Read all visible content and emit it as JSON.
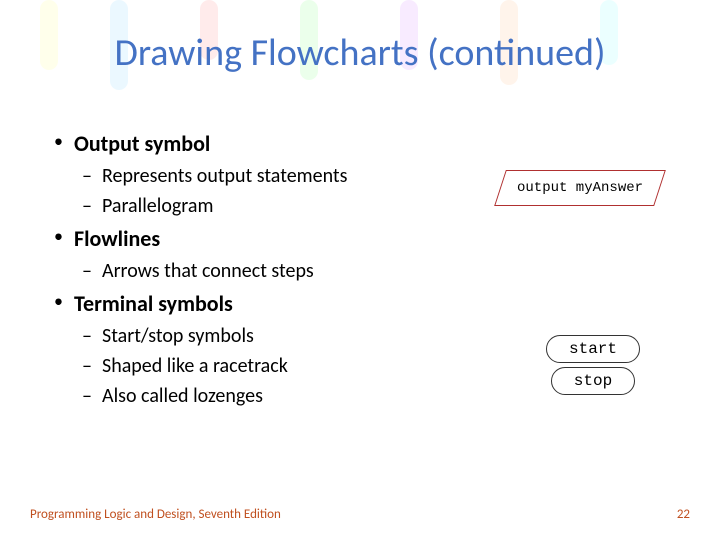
{
  "title": "Drawing Flowcharts (continued)",
  "bullets": [
    {
      "label": "Output symbol",
      "subs": [
        "Represents output statements",
        "Parallelogram"
      ]
    },
    {
      "label": "Flowlines",
      "subs": [
        "Arrows that connect steps"
      ]
    },
    {
      "label": "Terminal symbols",
      "subs": [
        "Start/stop symbols",
        "Shaped like a racetrack",
        "Also called lozenges"
      ]
    }
  ],
  "diagrams": {
    "output_text": "output myAnswer",
    "start_text": "start",
    "stop_text": "stop"
  },
  "footer": {
    "left": "Programming Logic and Design, Seventh Edition",
    "right": "22"
  }
}
